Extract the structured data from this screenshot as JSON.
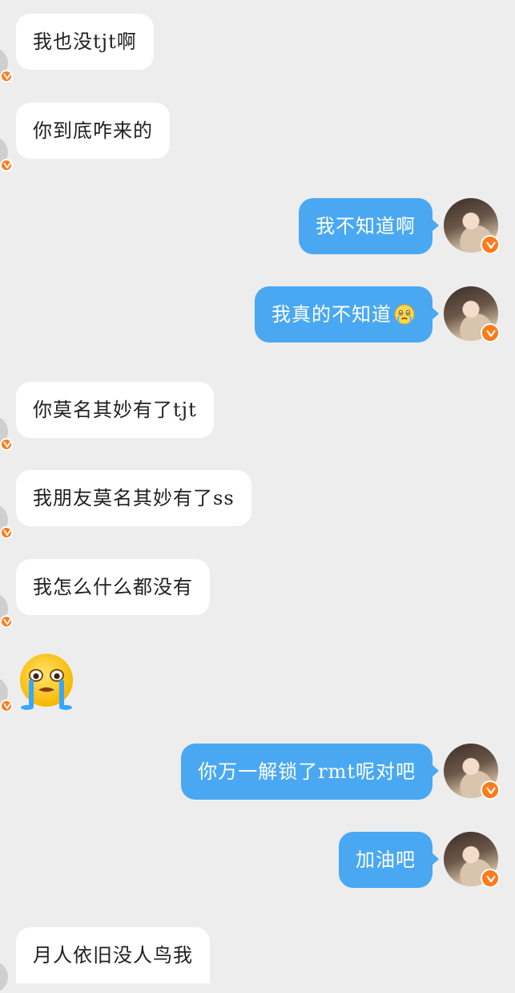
{
  "conversation": {
    "messages": [
      {
        "side": "in",
        "text": "我也没tjt啊"
      },
      {
        "side": "in",
        "text": "你到底咋来的"
      },
      {
        "side": "out",
        "text": "我不知道啊"
      },
      {
        "side": "out",
        "text": "我真的不知道",
        "emoji": "crying-emoji"
      },
      {
        "side": "in",
        "text": "你莫名其妙有了tjt"
      },
      {
        "side": "in",
        "text": "我朋友莫名其妙有了ss"
      },
      {
        "side": "in",
        "text": "我怎么什么都没有"
      },
      {
        "side": "in",
        "sticker": "sobbing-face-sticker"
      },
      {
        "side": "out",
        "text": "你万一解锁了rmt呢对吧"
      },
      {
        "side": "out",
        "text": "加油吧"
      },
      {
        "side": "in",
        "text": "月人依旧没人鸟我"
      }
    ]
  },
  "colors": {
    "background": "#ededed",
    "incoming_bubble": "#ffffff",
    "outgoing_bubble": "#4aa8f3",
    "verified_badge": "#ff7a1a"
  },
  "icons": {
    "verified_badge": "verified-v-icon",
    "own_avatar": "user-avatar"
  }
}
